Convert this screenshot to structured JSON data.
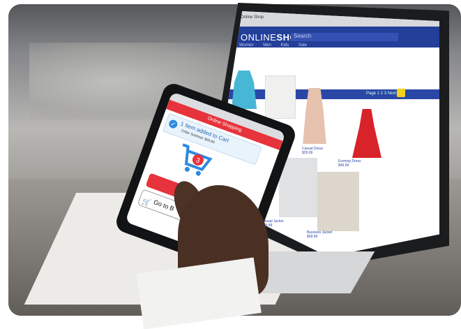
{
  "laptop": {
    "browser_tab": "Online Shop",
    "shop_logo_light": "ONLINE",
    "shop_logo_bold": "SHOP",
    "search_placeholder": "Search",
    "nav": [
      "Women",
      "Men",
      "Kids",
      "Sale"
    ],
    "pager": "Page 1 2 3 Next",
    "products": [
      {
        "name": "Casual Dress",
        "price": "$29.99"
      },
      {
        "name": "Evening Dress",
        "price": "$49.99"
      },
      {
        "name": "Casual Jacket",
        "price": "$49.99"
      },
      {
        "name": "Business Jacket",
        "price": "$99.99"
      }
    ]
  },
  "phone": {
    "header": "Online Shopping",
    "notice_title": "1 Item added to Cart",
    "notice_subtitle": "Order Subtotal: $99.99",
    "cart_badge": "3",
    "go_button": "Go to B"
  },
  "colors": {
    "shop_blue": "#233f9a",
    "phone_red": "#e7333b",
    "cart_blue": "#2d8ae0",
    "search_yellow": "#f2d21e"
  }
}
